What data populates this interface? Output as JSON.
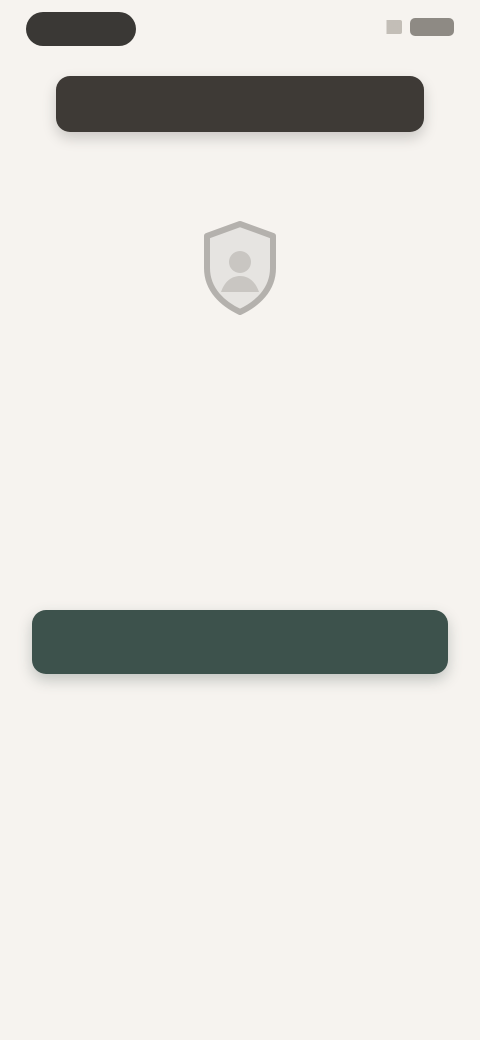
{
  "status_bar": {
    "signal_icon": "signal-icon",
    "battery_icon": "battery-icon"
  },
  "banner": {
    "text": ""
  },
  "hero": {
    "icon": "shield-user-icon",
    "title": "",
    "body": ""
  },
  "hint": {
    "text": ""
  },
  "actions": {
    "primary_label": "",
    "secondary_label": "",
    "tertiary_label": ""
  },
  "colors": {
    "background": "#f6f3ef",
    "banner": "#3e3a36",
    "primary": "#3d524c",
    "text_dark": "#2f2d2a",
    "text_muted": "#5b5853"
  }
}
